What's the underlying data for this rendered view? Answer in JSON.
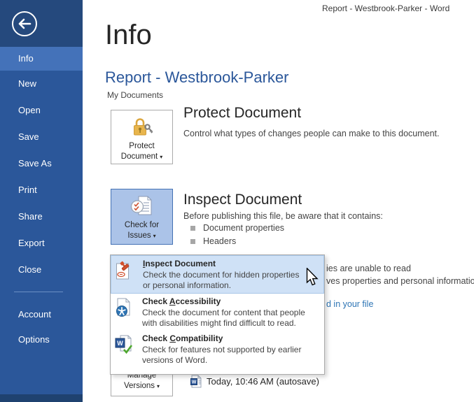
{
  "window": {
    "title": "Report - Westbrook-Parker - Word"
  },
  "ui": {
    "dropdown_arrow": "▾"
  },
  "colors": {
    "sidebar": "#2b579a",
    "sidebar_top": "#25497d",
    "sidebar_selected": "#4472b9",
    "title_blue": "#2b579a",
    "link_blue": "#2e75b5",
    "active_button_bg": "#abc3e8",
    "active_button_border": "#4472b4",
    "menu_highlight_bg": "#cfe1f6"
  },
  "sidebar": {
    "items": [
      {
        "label": "Info"
      },
      {
        "label": "New"
      },
      {
        "label": "Open"
      },
      {
        "label": "Save"
      },
      {
        "label": "Save As"
      },
      {
        "label": "Print"
      },
      {
        "label": "Share"
      },
      {
        "label": "Export"
      },
      {
        "label": "Close"
      },
      {
        "label": "Account"
      },
      {
        "label": "Options"
      }
    ],
    "selected": "Info"
  },
  "main": {
    "page_title": "Info",
    "doc_title": "Report - Westbrook-Parker",
    "doc_location": "My Documents",
    "protect": {
      "button_label_1": "Protect",
      "button_label_2": "Document",
      "heading": "Protect Document",
      "description": "Control what types of changes people can make to this document."
    },
    "inspect": {
      "button_label_1": "Check for",
      "button_label_2": "Issues",
      "heading": "Inspect Document",
      "intro": "Before publishing this file, be aware that it contains:",
      "bullets": [
        "Document properties",
        "Headers"
      ]
    },
    "fragments": {
      "line1": "ies are unable to read",
      "line2": "ves properties and personal information",
      "link": "d in your file"
    },
    "versions": {
      "button_label_1": "Manage",
      "button_label_2": "Versions",
      "autosave": "Today, 10:46 AM (autosave)"
    }
  },
  "menu": {
    "items": [
      {
        "title_pre": "",
        "title_key": "I",
        "title_post": "nspect Document",
        "desc1": "Check the document for hidden properties",
        "desc2": "or personal information.",
        "highlighted": true
      },
      {
        "title_pre": "Check ",
        "title_key": "A",
        "title_post": "ccessibility",
        "desc1": "Check the document for content that people",
        "desc2": "with disabilities might find difficult to read.",
        "highlighted": false
      },
      {
        "title_pre": "Check ",
        "title_key": "C",
        "title_post": "ompatibility",
        "desc1": "Check for features not supported by earlier",
        "desc2": "versions of Word.",
        "highlighted": false
      }
    ]
  }
}
